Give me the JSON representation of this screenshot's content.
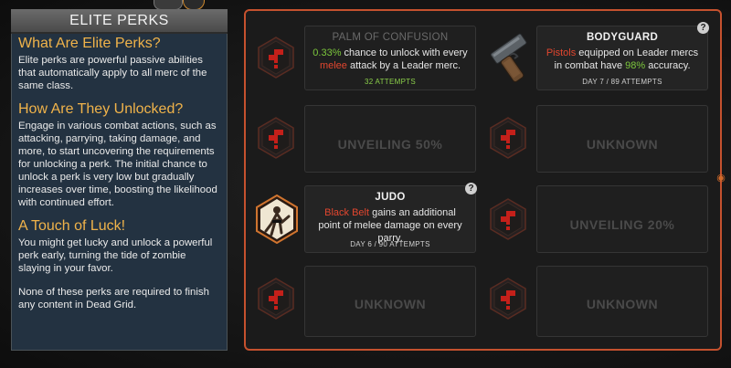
{
  "header": {
    "title": "ELITE PERKS"
  },
  "info": {
    "sections": [
      {
        "heading": "What Are Elite Perks?",
        "body": "Elite perks are powerful passive abilities that automatically apply to all merc of the same class."
      },
      {
        "heading": "How Are They Unlocked?",
        "body": "Engage in various combat actions, such as attacking, parrying, taking damage, and more, to start uncovering the requirements for unlocking a perk. The initial chance to unlock a perk is very low but gradually increases over time, boosting the likelihood with continued effort."
      },
      {
        "heading": "A Touch of Luck!",
        "body": "You might get lucky and unlock a powerful perk early, turning the tide of zombie slaying in your favor."
      }
    ],
    "footer": "None of these perks are required to finish any content in Dead Grid."
  },
  "perks": {
    "palm": {
      "title": "PALM OF CONFUSION",
      "pct": "0.33%",
      "desc_a": " chance to unlock with every ",
      "kw": "melee",
      "desc_b": " attack by a Leader merc.",
      "foot": "32 ATTEMPTS"
    },
    "bodyguard": {
      "title": "BODYGUARD",
      "kw": "Pistols",
      "desc_a": " equipped on Leader mercs in combat have ",
      "pct": "98%",
      "desc_b": " accuracy.",
      "foot": "DAY 7 / 89 ATTEMPTS",
      "help": "?"
    },
    "unveil50": {
      "label": "UNVEILING 50%"
    },
    "unknown1": {
      "label": "UNKNOWN"
    },
    "judo": {
      "title": "JUDO",
      "kw": "Black Belt",
      "desc_a": " gains an additional point of melee damage on every parry.",
      "foot": "DAY 6 / 90 ATTEMPTS",
      "help": "?"
    },
    "unveil20": {
      "label": "UNVEILING 20%"
    },
    "unknown2": {
      "label": "UNKNOWN"
    },
    "unknown3": {
      "label": "UNKNOWN"
    }
  },
  "colors": {
    "accent": "#c5512e",
    "heading": "#f0b34a",
    "keyword_red": "#e2462f",
    "keyword_green": "#7cc73c"
  },
  "icons": {
    "locked": "question-hex-icon",
    "bodyguard": "pistol-icon",
    "judo": "fighter-icon",
    "scroll": "skull-icon"
  }
}
